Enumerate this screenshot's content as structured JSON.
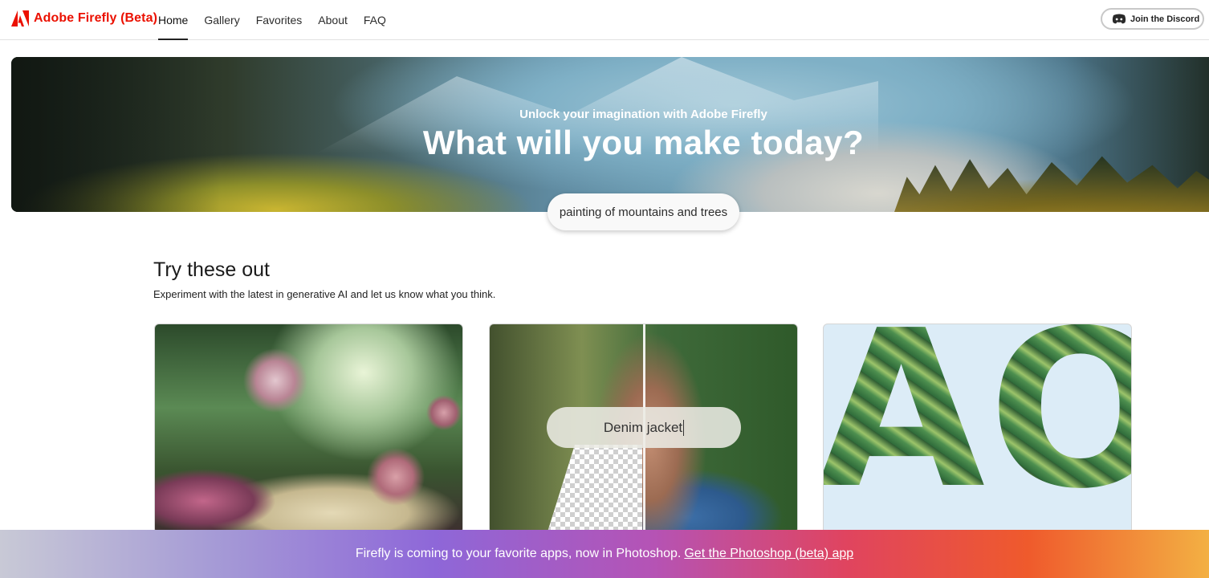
{
  "header": {
    "brand": "Adobe Firefly (Beta)",
    "nav": [
      {
        "label": "Home",
        "active": true
      },
      {
        "label": "Gallery",
        "active": false
      },
      {
        "label": "Favorites",
        "active": false
      },
      {
        "label": "About",
        "active": false
      },
      {
        "label": "FAQ",
        "active": false
      }
    ],
    "discord_label": "Join the Discord"
  },
  "hero": {
    "subtitle": "Unlock your imagination with Adobe Firefly",
    "title": "What will you make today?",
    "prompt": "painting of mountains and trees"
  },
  "section": {
    "title": "Try these out",
    "subtitle": "Experiment with the latest in generative AI and let us know what you think."
  },
  "cards": [
    {
      "name": "fantasy-garden-image"
    },
    {
      "name": "generative-fill-portrait-image",
      "prompt": "Denim jacket"
    },
    {
      "name": "text-effects-image",
      "letters": [
        "A",
        "O"
      ]
    }
  ],
  "banner": {
    "text": "Firefly is coming to your favorite apps, now in Photoshop.",
    "link": "Get the Photoshop (beta) app"
  },
  "colors": {
    "brand_red": "#eb1000",
    "banner_gradient": [
      "#c8c9d6",
      "#8e67d8",
      "#e0445f",
      "#f3b043"
    ]
  }
}
